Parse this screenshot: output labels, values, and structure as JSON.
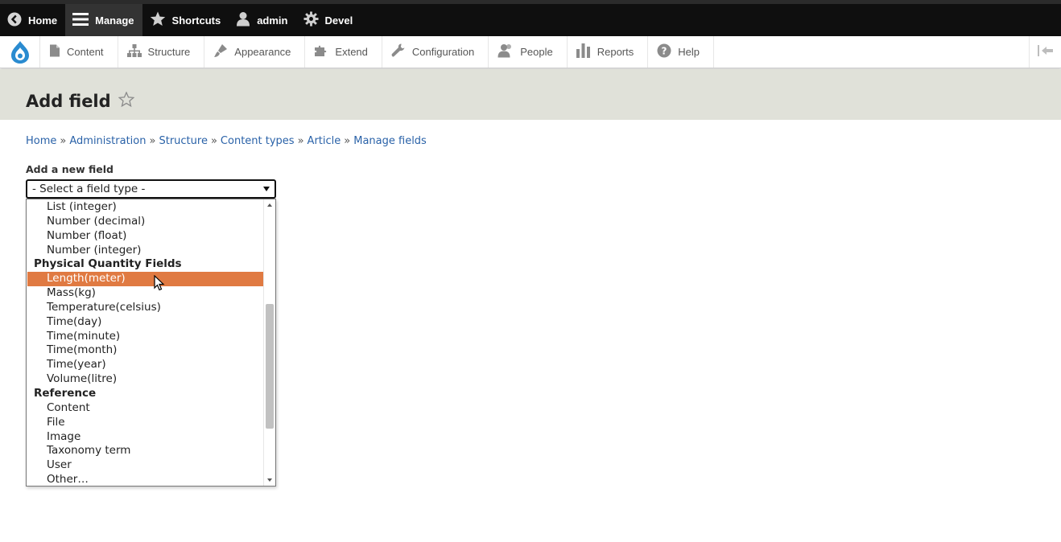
{
  "toolbar": {
    "items": [
      {
        "label": "Home",
        "icon": "back-circle-icon"
      },
      {
        "label": "Manage",
        "icon": "hamburger-icon"
      },
      {
        "label": "Shortcuts",
        "icon": "star-icon"
      },
      {
        "label": "admin",
        "icon": "user-icon"
      },
      {
        "label": "Devel",
        "icon": "gear-icon"
      }
    ]
  },
  "tray": {
    "items": [
      {
        "label": "Content",
        "icon": "document-icon"
      },
      {
        "label": "Structure",
        "icon": "sitemap-icon"
      },
      {
        "label": "Appearance",
        "icon": "brush-icon"
      },
      {
        "label": "Extend",
        "icon": "puzzle-icon"
      },
      {
        "label": "Configuration",
        "icon": "wrench-icon"
      },
      {
        "label": "People",
        "icon": "people-icon"
      },
      {
        "label": "Reports",
        "icon": "bars-icon"
      },
      {
        "label": "Help",
        "icon": "help-icon"
      }
    ]
  },
  "page": {
    "title": "Add field"
  },
  "breadcrumb": {
    "items": [
      "Home",
      "Administration",
      "Structure",
      "Content types",
      "Article",
      "Manage fields"
    ],
    "separator": "»"
  },
  "form": {
    "label": "Add a new field",
    "select_value": "- Select a field type -",
    "options": [
      {
        "label": "List (integer)",
        "group": false
      },
      {
        "label": "Number (decimal)",
        "group": false
      },
      {
        "label": "Number (float)",
        "group": false
      },
      {
        "label": "Number (integer)",
        "group": false
      },
      {
        "label": "Physical Quantity Fields",
        "group": true
      },
      {
        "label": "Length(meter)",
        "group": false,
        "selected": true
      },
      {
        "label": "Mass(kg)",
        "group": false
      },
      {
        "label": "Temperature(celsius)",
        "group": false
      },
      {
        "label": "Time(day)",
        "group": false
      },
      {
        "label": "Time(minute)",
        "group": false
      },
      {
        "label": "Time(month)",
        "group": false
      },
      {
        "label": "Time(year)",
        "group": false
      },
      {
        "label": "Volume(litre)",
        "group": false
      },
      {
        "label": "Reference",
        "group": true
      },
      {
        "label": "Content",
        "group": false
      },
      {
        "label": "File",
        "group": false
      },
      {
        "label": "Image",
        "group": false
      },
      {
        "label": "Taxonomy term",
        "group": false
      },
      {
        "label": "User",
        "group": false
      },
      {
        "label": "Other…",
        "group": false
      }
    ]
  },
  "colors": {
    "highlight": "#e07a42",
    "link": "#2a62a8",
    "header_bg": "#e0e1d9",
    "toolbar_bg": "#0f0f0f"
  }
}
